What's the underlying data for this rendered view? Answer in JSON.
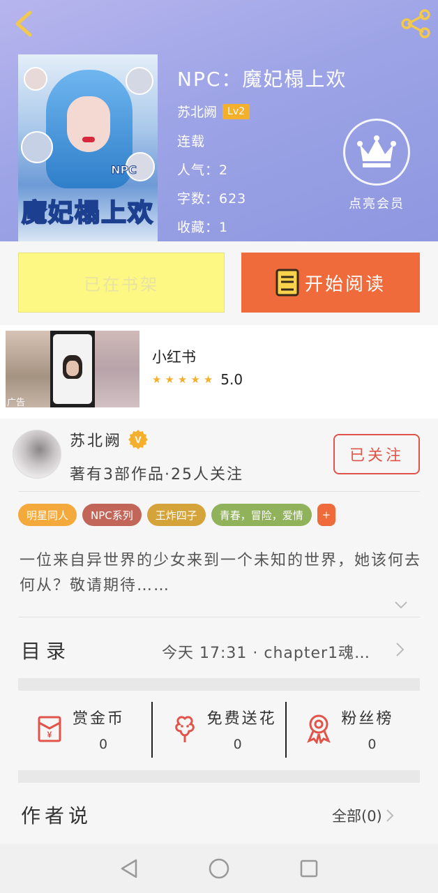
{
  "header": {
    "back_icon": "chevron-left-icon",
    "share_icon": "share-icon"
  },
  "book": {
    "title": "NPC：魔妃榻上欢",
    "author": "苏北阙",
    "level": "Lv2",
    "status": "连载",
    "popularity": "人气：2",
    "word_count": "字数：623",
    "favorites": "收藏：1",
    "cover_text": "魔妃榻上欢",
    "cover_npc": "NPC"
  },
  "vip": {
    "label": "点亮会员",
    "icon": "crown-icon"
  },
  "actions": {
    "shelf_label": "已在书架",
    "read_label": "开始阅读",
    "read_icon": "book-icon"
  },
  "ad": {
    "name": "小红书",
    "rating": "5.0",
    "stars": 5,
    "tag": "广告"
  },
  "author_card": {
    "name": "苏北阙",
    "verified_badge": "V",
    "stats": "著有3部作品·25人关注",
    "follow_label": "已关注"
  },
  "tags": [
    {
      "label": "明星同人",
      "color": "#f4a93c"
    },
    {
      "label": "NPC系列",
      "color": "#c2665a"
    },
    {
      "label": "王炸四子",
      "color": "#d4a33a"
    },
    {
      "label": "青春，冒险，爱情",
      "color": "#8fb25a"
    },
    {
      "label": "+",
      "color": "#ef6b3b"
    }
  ],
  "description": "一位来自异世界的少女来到一个未知的世界，她该何去何从？敬请期待……",
  "toc": {
    "label": "目录",
    "latest": "今天 17:31 · chapter1魂…"
  },
  "stats": [
    {
      "label": "赏金币",
      "value": "0",
      "icon": "red-envelope-icon"
    },
    {
      "label": "免费送花",
      "value": "0",
      "icon": "flower-icon"
    },
    {
      "label": "粉丝榜",
      "value": "0",
      "icon": "medal-icon"
    }
  ],
  "author_saying": {
    "title": "作者说",
    "all_label": "全部(0)"
  },
  "colors": {
    "accent_orange": "#ef6b3b",
    "shelf_yellow": "#fdf783",
    "follow_red": "#e0544a",
    "level_badge": "#f4b02c"
  }
}
